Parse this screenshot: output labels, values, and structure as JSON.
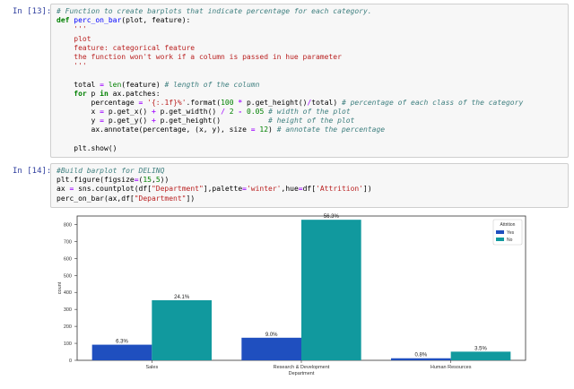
{
  "cells": [
    {
      "prompt": "In [13]:",
      "lines": [
        [
          {
            "t": "# Function to create barplots that indicate percentage for each category.",
            "c": "cm"
          }
        ],
        [
          {
            "t": "def",
            "c": "kw"
          },
          {
            "t": " "
          },
          {
            "t": "perc_on_bar",
            "c": "fn"
          },
          {
            "t": "(plot, feature):"
          }
        ],
        [
          {
            "t": "    '''",
            "c": "st"
          }
        ],
        [
          {
            "t": "    plot",
            "c": "st"
          }
        ],
        [
          {
            "t": "    feature: categorical feature",
            "c": "st"
          }
        ],
        [
          {
            "t": "    the function won't work if a column is passed in hue parameter",
            "c": "st"
          }
        ],
        [
          {
            "t": "    '''",
            "c": "st"
          }
        ],
        [
          {
            "t": ""
          }
        ],
        [
          {
            "t": "    total "
          },
          {
            "t": "=",
            "c": "op"
          },
          {
            "t": " "
          },
          {
            "t": "len",
            "c": "nb"
          },
          {
            "t": "(feature) "
          },
          {
            "t": "# length of the column",
            "c": "cm"
          }
        ],
        [
          {
            "t": "    "
          },
          {
            "t": "for",
            "c": "kw"
          },
          {
            "t": " p "
          },
          {
            "t": "in",
            "c": "kw"
          },
          {
            "t": " ax.patches:"
          }
        ],
        [
          {
            "t": "        percentage "
          },
          {
            "t": "=",
            "c": "op"
          },
          {
            "t": " "
          },
          {
            "t": "'{:.1f}%'",
            "c": "st"
          },
          {
            "t": ".format("
          },
          {
            "t": "100",
            "c": "nu"
          },
          {
            "t": " "
          },
          {
            "t": "*",
            "c": "op"
          },
          {
            "t": " p.get_height()"
          },
          {
            "t": "/",
            "c": "op"
          },
          {
            "t": "total) "
          },
          {
            "t": "# percentage of each class of the category",
            "c": "cm"
          }
        ],
        [
          {
            "t": "        x "
          },
          {
            "t": "=",
            "c": "op"
          },
          {
            "t": " p.get_x() "
          },
          {
            "t": "+",
            "c": "op"
          },
          {
            "t": " p.get_width() "
          },
          {
            "t": "/",
            "c": "op"
          },
          {
            "t": " "
          },
          {
            "t": "2",
            "c": "nu"
          },
          {
            "t": " "
          },
          {
            "t": "-",
            "c": "op"
          },
          {
            "t": " "
          },
          {
            "t": "0.05",
            "c": "nu"
          },
          {
            "t": " "
          },
          {
            "t": "# width of the plot",
            "c": "cm"
          }
        ],
        [
          {
            "t": "        y "
          },
          {
            "t": "=",
            "c": "op"
          },
          {
            "t": " p.get_y() "
          },
          {
            "t": "+",
            "c": "op"
          },
          {
            "t": " p.get_height()           "
          },
          {
            "t": "# height of the plot",
            "c": "cm"
          }
        ],
        [
          {
            "t": "        ax.annotate(percentage, (x, y), size "
          },
          {
            "t": "=",
            "c": "op"
          },
          {
            "t": " "
          },
          {
            "t": "12",
            "c": "nu"
          },
          {
            "t": ") "
          },
          {
            "t": "# annotate the percentage",
            "c": "cm"
          }
        ],
        [
          {
            "t": ""
          }
        ],
        [
          {
            "t": "    plt.show()"
          }
        ]
      ]
    },
    {
      "prompt": "In [14]:",
      "lines": [
        [
          {
            "t": "#Build barplot for DELINQ",
            "c": "cm"
          }
        ],
        [
          {
            "t": "plt.figure(figsize"
          },
          {
            "t": "=",
            "c": "op"
          },
          {
            "t": "("
          },
          {
            "t": "15",
            "c": "nu"
          },
          {
            "t": ","
          },
          {
            "t": "5",
            "c": "nu"
          },
          {
            "t": "))"
          }
        ],
        [
          {
            "t": "ax "
          },
          {
            "t": "=",
            "c": "op"
          },
          {
            "t": " sns.countplot(df["
          },
          {
            "t": "\"Department\"",
            "c": "st"
          },
          {
            "t": "],palette"
          },
          {
            "t": "=",
            "c": "op"
          },
          {
            "t": "'winter'",
            "c": "st"
          },
          {
            "t": ",hue"
          },
          {
            "t": "=",
            "c": "op"
          },
          {
            "t": "df["
          },
          {
            "t": "'Attrition'",
            "c": "st"
          },
          {
            "t": "])"
          }
        ],
        [
          {
            "t": "perc_on_bar(ax,df["
          },
          {
            "t": "\"Department\"",
            "c": "st"
          },
          {
            "t": "])"
          }
        ]
      ]
    }
  ],
  "chart_data": {
    "type": "bar",
    "categories": [
      "Sales",
      "Research & Development",
      "Human Resources"
    ],
    "series": [
      {
        "name": "Yes",
        "color": "#1f4fbf",
        "values": [
          92,
          133,
          12
        ],
        "labels": [
          "6.3%",
          "9.0%",
          "0.8%"
        ]
      },
      {
        "name": "No",
        "color": "#11999e",
        "values": [
          354,
          828,
          51
        ],
        "labels": [
          "24.1%",
          "56.3%",
          "3.5%"
        ]
      }
    ],
    "xlabel": "Department",
    "ylabel": "count",
    "ylim": [
      0,
      850
    ],
    "yticks": [
      0,
      100,
      200,
      300,
      400,
      500,
      600,
      700,
      800
    ],
    "legend_title": "Attrition",
    "legend_position": "top-right",
    "grid": false
  }
}
